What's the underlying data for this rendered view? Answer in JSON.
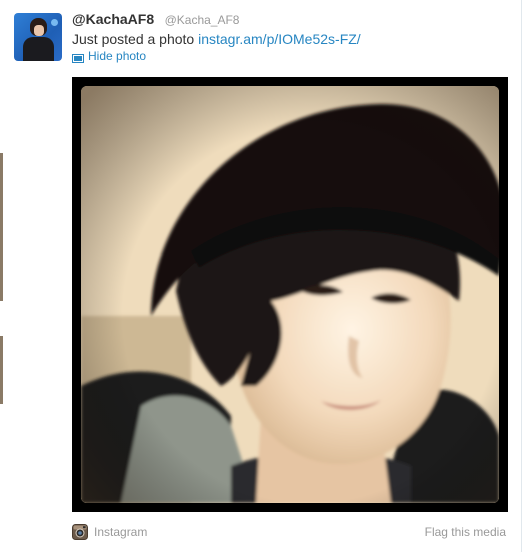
{
  "tweet": {
    "display_name": "@KachaAF8",
    "screen_name": "@Kacha_AF8",
    "text": "Just posted a photo ",
    "link": "instagr.am/p/IOMe52s-FZ/",
    "hide_photo": "Hide photo"
  },
  "media": {
    "source_label": "Instagram",
    "flag_label": "Flag this media"
  },
  "colors": {
    "link": "#2786c2",
    "muted": "#999999",
    "text": "#333333",
    "frame": "#000000"
  },
  "icons": {
    "photo": "photo-icon",
    "instagram": "instagram-icon"
  }
}
